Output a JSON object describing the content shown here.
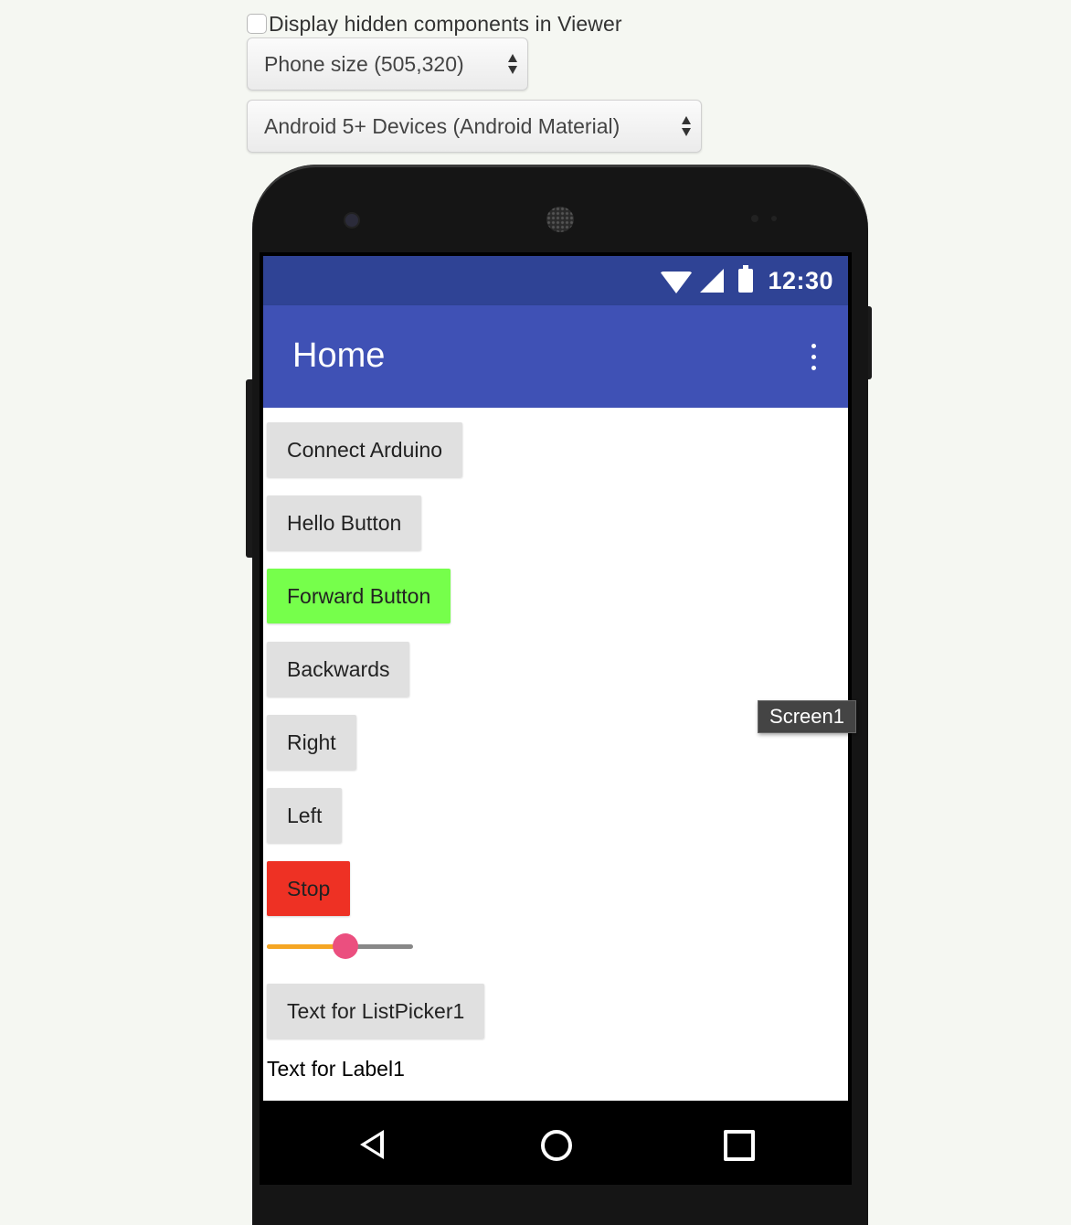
{
  "viewer": {
    "hidden_components_label": "Display hidden components in Viewer",
    "hidden_components_checked": false,
    "size_select": "Phone size (505,320)",
    "theme_select": "Android 5+ Devices (Android Material)"
  },
  "status_bar": {
    "time": "12:30",
    "color": "#2f4395"
  },
  "app_bar": {
    "title": "Home",
    "color": "#3f51b5"
  },
  "buttons": [
    {
      "label": "Connect Arduino",
      "color": "#e0e0e0"
    },
    {
      "label": "Hello Button",
      "color": "#e0e0e0"
    },
    {
      "label": "Forward Button",
      "color": "#76ff4b"
    },
    {
      "label": "Backwards",
      "color": "#e0e0e0"
    },
    {
      "label": "Right",
      "color": "#e0e0e0"
    },
    {
      "label": "Left",
      "color": "#e0e0e0"
    },
    {
      "label": "Stop",
      "color": "#ee3124"
    }
  ],
  "slider": {
    "value_fraction": 0.54,
    "fill_color": "#f5a623",
    "thumb_color": "#eb4f7f"
  },
  "list_picker": {
    "label": "Text for ListPicker1"
  },
  "label1": {
    "text": "Text for Label1"
  },
  "screen_tag": "Screen1"
}
